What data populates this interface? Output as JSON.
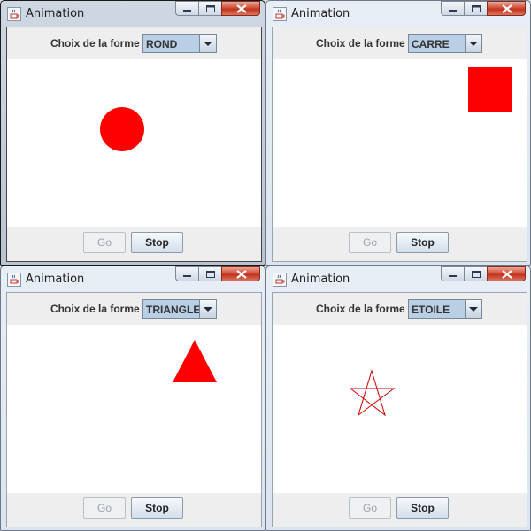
{
  "colors": {
    "shape": "#ff0000",
    "canvas": "#ffffff"
  },
  "windows": [
    {
      "title": "Animation",
      "label": "Choix de la forme",
      "selected": "ROND",
      "shape": "circle-shape",
      "go": "Go",
      "stop": "Stop"
    },
    {
      "title": "Animation",
      "label": "Choix de la forme",
      "selected": "CARRE",
      "shape": "square-shape",
      "go": "Go",
      "stop": "Stop"
    },
    {
      "title": "Animation",
      "label": "Choix de la forme",
      "selected": "TRIANGLE",
      "shape": "triangle-shape",
      "go": "Go",
      "stop": "Stop"
    },
    {
      "title": "Animation",
      "label": "Choix de la forme",
      "selected": "ETOILE",
      "shape": "star-shape",
      "go": "Go",
      "stop": "Stop"
    }
  ]
}
